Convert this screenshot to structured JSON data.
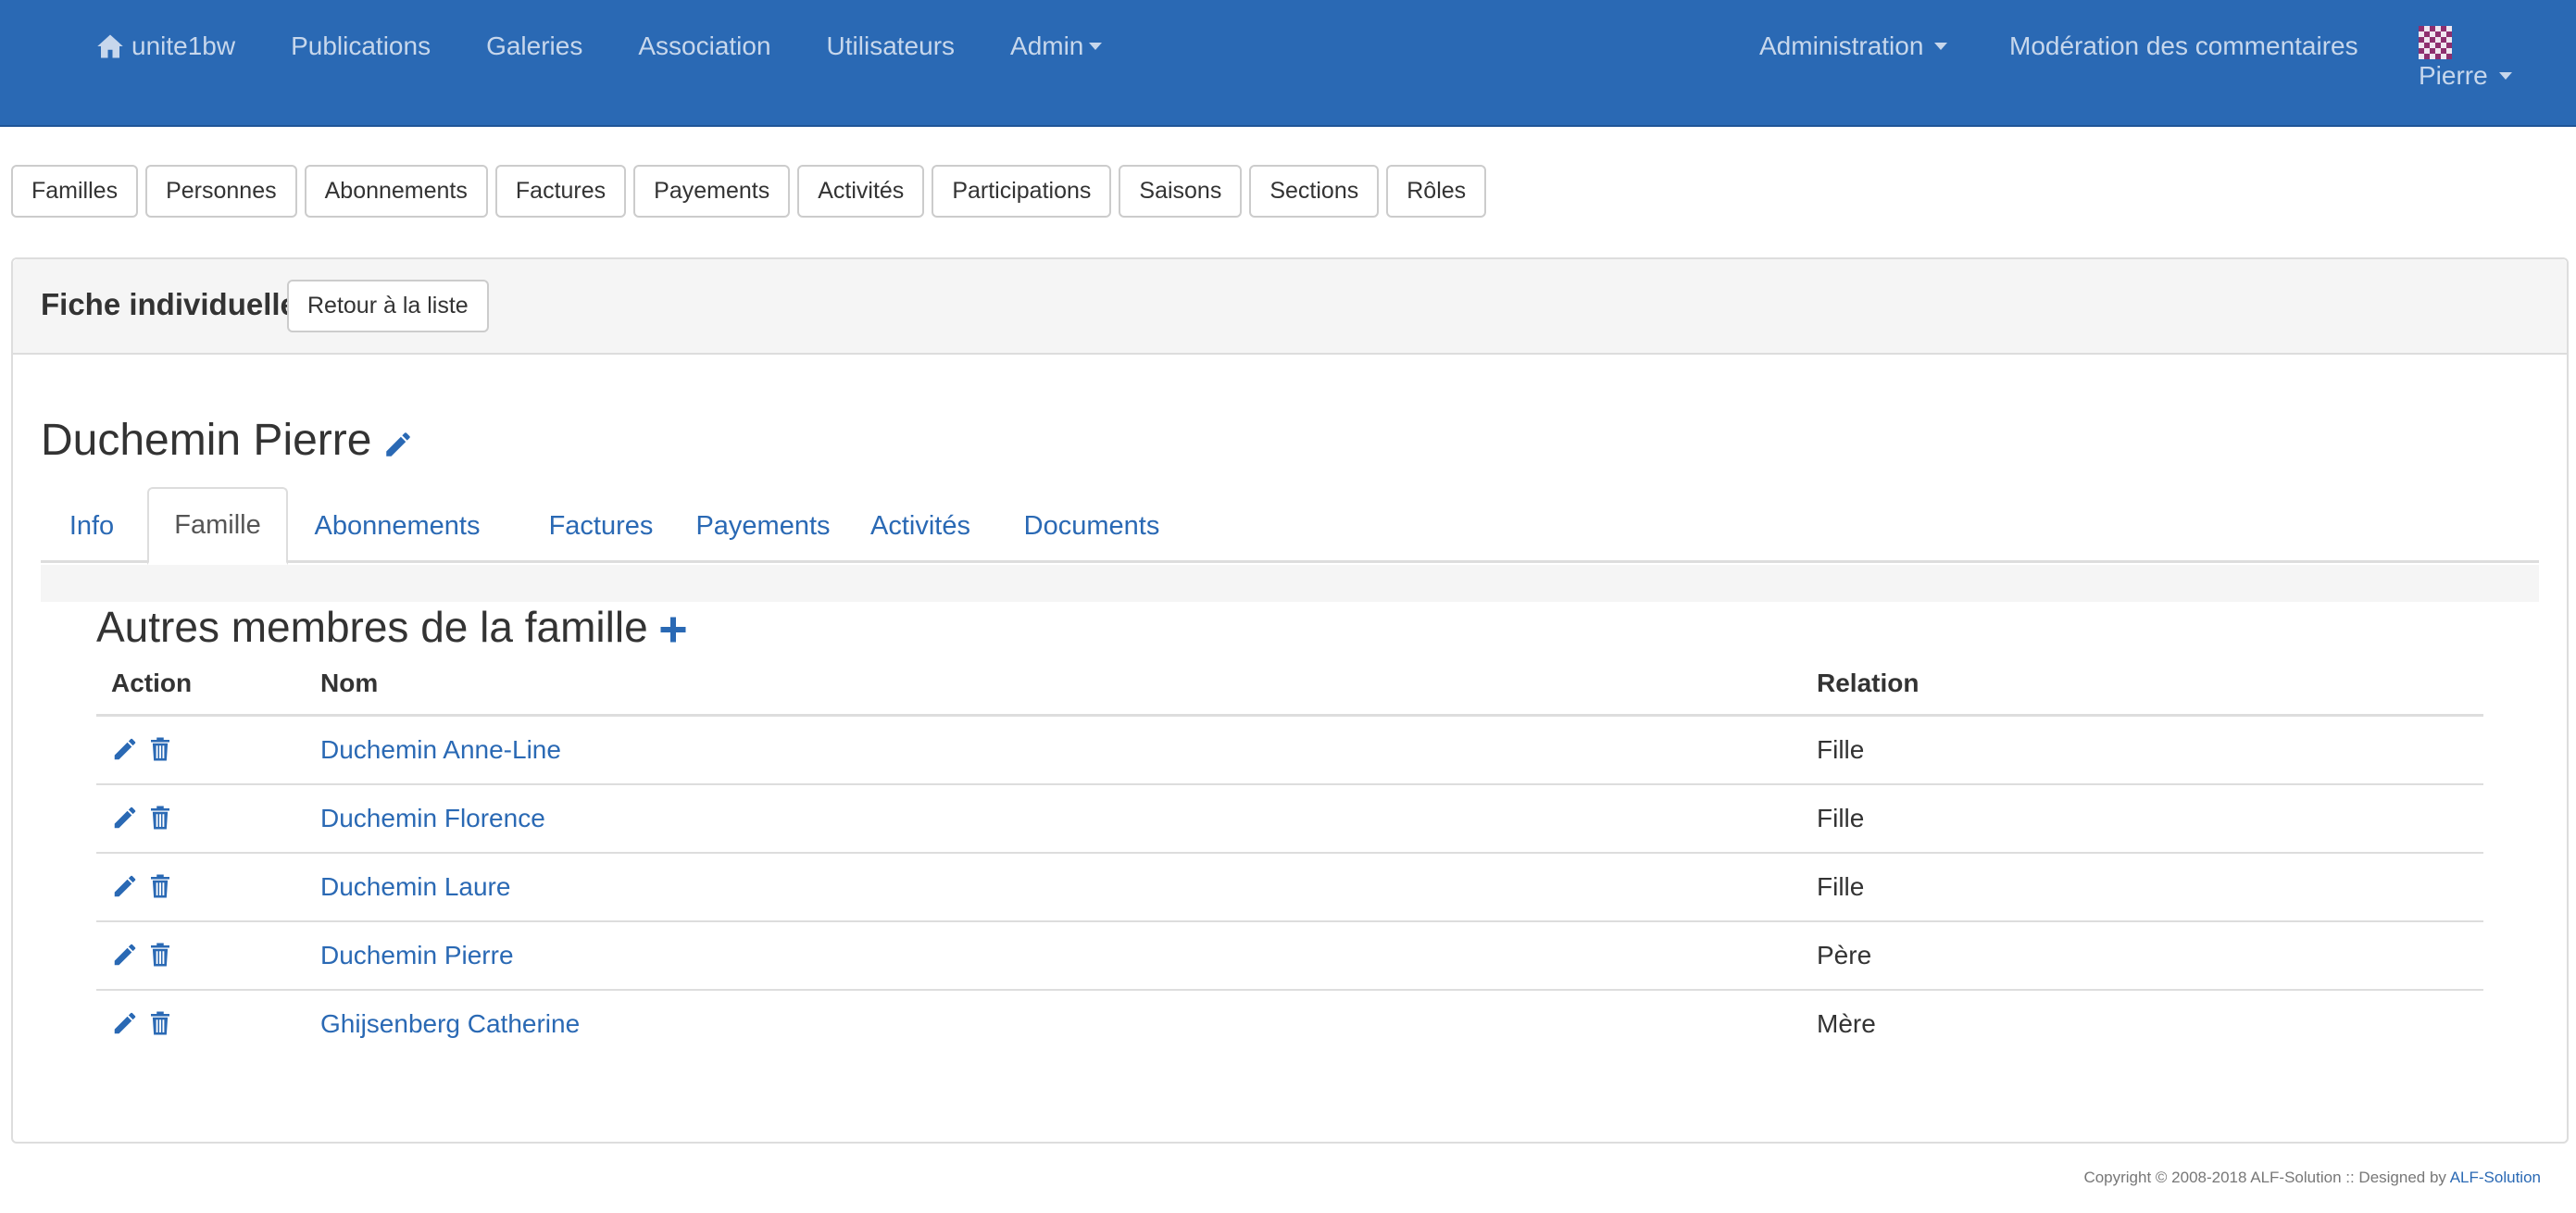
{
  "navbar": {
    "brand": "unite1bw",
    "items": [
      "Publications",
      "Galeries",
      "Association",
      "Utilisateurs",
      "Admin"
    ],
    "right_admin": "Administration",
    "right_moderation": "Modération des commentaires",
    "user": "Pierre"
  },
  "subnav": [
    "Familles",
    "Personnes",
    "Abonnements",
    "Factures",
    "Payements",
    "Activités",
    "Participations",
    "Saisons",
    "Sections",
    "Rôles"
  ],
  "panel": {
    "title": "Fiche individuelle",
    "back_label": "Retour à la liste"
  },
  "person": {
    "name": "Duchemin Pierre"
  },
  "tabs": [
    "Info",
    "Famille",
    "Abonnements",
    "Factures",
    "Payements",
    "Activités",
    "Documents"
  ],
  "active_tab": "Famille",
  "section": {
    "title": "Autres membres de la famille"
  },
  "table": {
    "headers": [
      "Action",
      "Nom",
      "Relation"
    ],
    "rows": [
      {
        "name": "Duchemin Anne-Line",
        "relation": "Fille"
      },
      {
        "name": "Duchemin Florence",
        "relation": "Fille"
      },
      {
        "name": "Duchemin Laure",
        "relation": "Fille"
      },
      {
        "name": "Duchemin Pierre",
        "relation": "Père"
      },
      {
        "name": "Ghijsenberg Catherine",
        "relation": "Mère"
      }
    ]
  },
  "footer": {
    "text": "Copyright © 2008-2018 ALF-Solution :: Designed by",
    "link": "ALF-Solution"
  },
  "colors": {
    "navbar": "#2a69b4",
    "link": "#2a69b4",
    "nav_text": "#c7d7ec"
  },
  "icons": [
    "home-icon",
    "caret-down-icon",
    "avatar-icon",
    "pencil-icon",
    "trash-icon",
    "plus-icon"
  ]
}
